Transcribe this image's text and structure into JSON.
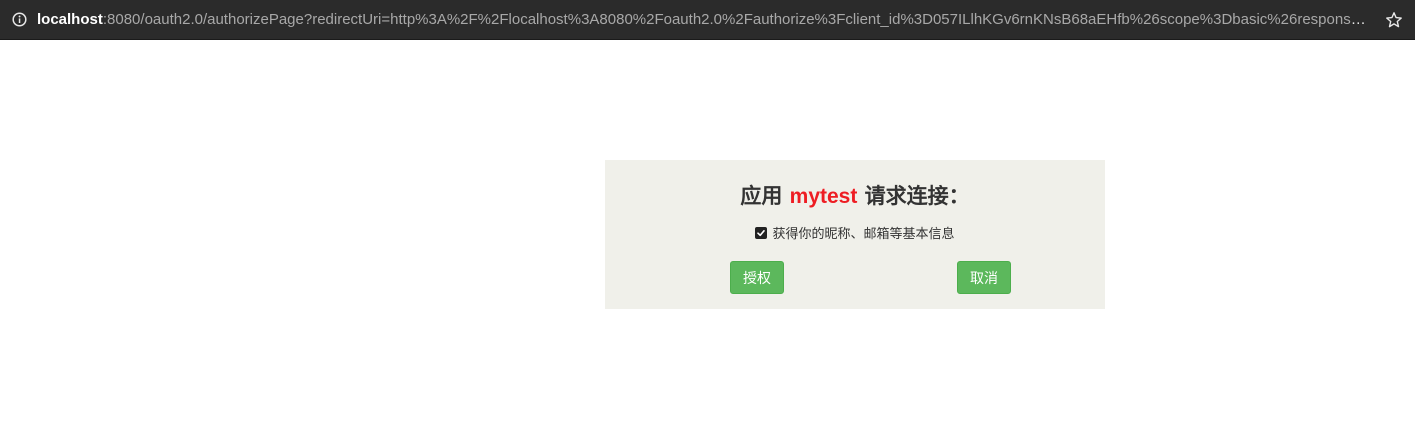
{
  "browser": {
    "url_host": "localhost",
    "url_rest": ":8080/oauth2.0/authorizePage?redirectUri=http%3A%2F%2Flocalhost%3A8080%2Foauth2.0%2Fauthorize%3Fclient_id%3D057ILlhKGv6rnKNsB68aEHfb%26scope%3Dbasic%26response_type...",
    "icons": {
      "info": "info-circle-icon",
      "bookmark": "star-icon"
    }
  },
  "auth": {
    "title_prefix": "应用 ",
    "app_name": "mytest",
    "title_suffix": " 请求连接：",
    "scope_label": "获得你的昵称、邮箱等基本信息",
    "scope_checked": true,
    "authorize_label": "授权",
    "cancel_label": "取消"
  },
  "colors": {
    "panel_bg": "#f0f0ea",
    "app_name": "#ee1d23",
    "button_bg": "#5cb85c"
  }
}
